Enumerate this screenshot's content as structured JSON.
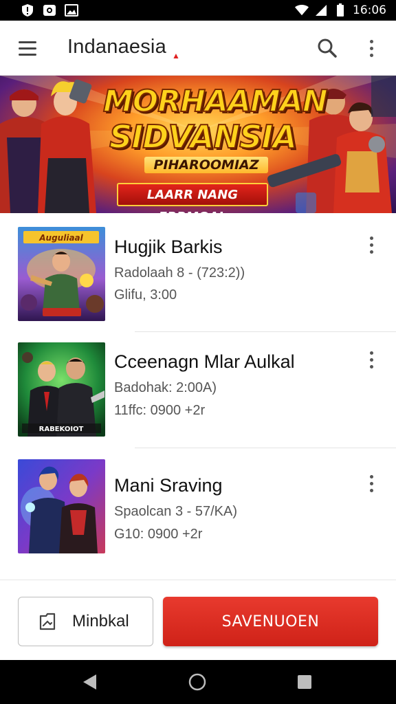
{
  "status_bar": {
    "time": "16:06",
    "icons": [
      "shield-alert-icon",
      "camera-icon",
      "image-icon",
      "wifi-icon",
      "signal-icon",
      "battery-icon"
    ]
  },
  "app_bar": {
    "title": "Indanaesia",
    "icons": [
      "menu-icon",
      "search-icon",
      "more-vertical-icon"
    ]
  },
  "banner": {
    "title_line1": "MORHAAMAN",
    "title_line2": "SIDVANSIA",
    "subtitle": "PIHAROOMIAZ",
    "cta": "LAARR NANG ERRMOAL"
  },
  "list": {
    "items": [
      {
        "title": "Hugjik Barkis",
        "subtitle": "Radolaah 8 - (723:2))",
        "meta": "Glifu, 3:00",
        "thumb_caption": "Auguliaal"
      },
      {
        "title": "Cceenagn Mlar Aulkal",
        "subtitle": "Badohak: 2:00A)",
        "meta": "11ffc: 0900 +2r",
        "thumb_caption": "RABEKOIOT"
      },
      {
        "title": "Mani Sraving",
        "subtitle": "Spaolcan 3 - 57/KA)",
        "meta": "G10: 0900 +2r",
        "thumb_caption": ""
      }
    ]
  },
  "bottom_actions": {
    "secondary_label": "Minbkal",
    "primary_label": "SAVENUOEN"
  },
  "colors": {
    "accent": "#d8291e",
    "status_bar_bg": "#000000",
    "nav_bar_bg": "#000000"
  }
}
